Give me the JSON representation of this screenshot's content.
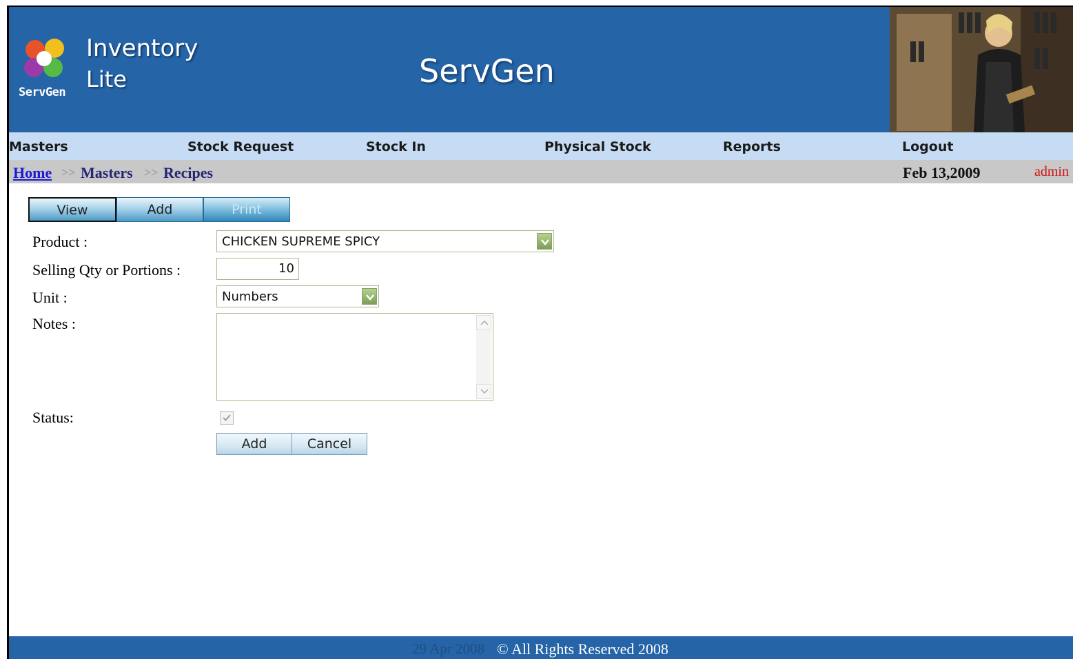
{
  "header": {
    "logo_text": "ServGen",
    "brand_line1": "Inventory",
    "brand_line2": "Lite",
    "app_title": "ServGen"
  },
  "menu": {
    "items": [
      "Masters",
      "Stock Request",
      "Stock In",
      "Physical Stock",
      "Reports",
      "Logout"
    ]
  },
  "breadcrumb": {
    "home": "Home",
    "separator": ">>",
    "level1": "Masters",
    "level2": "Recipes",
    "date": "Feb 13,2009",
    "user": "admin"
  },
  "tabs": {
    "view": "View",
    "add": "Add",
    "print": "Print"
  },
  "form": {
    "product_label": "Product :",
    "product_value": "CHICKEN SUPREME SPICY",
    "qty_label": "Selling Qty or Portions :",
    "qty_value": "10",
    "unit_label": "Unit :",
    "unit_value": "Numbers",
    "notes_label": "Notes :",
    "notes_value": "",
    "status_label": "Status:",
    "status_checked": true,
    "add_button": "Add",
    "cancel_button": "Cancel"
  },
  "footer": {
    "ghost_date": "29 Apr 2008",
    "copyright": "© All Rights Reserved 2008"
  },
  "colors": {
    "header_bg": "#2464a7",
    "menu_bg": "#c6dcf4",
    "crumb_bg": "#c8c8c8",
    "user_color": "#d01010"
  }
}
